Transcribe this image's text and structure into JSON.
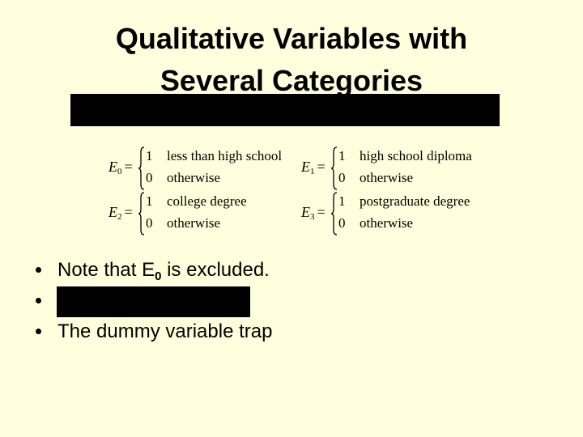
{
  "slide": {
    "title_line1": "Qualitative Variables with",
    "title_line2": "Several Categories",
    "background_color": "#ffffdd",
    "redaction_color": "#000000"
  },
  "equations": [
    {
      "var": "E",
      "sub": "0",
      "eq": "=",
      "rows": [
        {
          "value": "1",
          "label": "less than high school"
        },
        {
          "value": "0",
          "label": "otherwise"
        }
      ]
    },
    {
      "var": "E",
      "sub": "1",
      "eq": "=",
      "rows": [
        {
          "value": "1",
          "label": "high school diploma"
        },
        {
          "value": "0",
          "label": "otherwise"
        }
      ]
    },
    {
      "var": "E",
      "sub": "2",
      "eq": "=",
      "rows": [
        {
          "value": "1",
          "label": "college degree"
        },
        {
          "value": "0",
          "label": "otherwise"
        }
      ]
    },
    {
      "var": "E",
      "sub": "3",
      "eq": "=",
      "rows": [
        {
          "value": "1",
          "label": "postgraduate degree"
        },
        {
          "value": "0",
          "label": "otherwise"
        }
      ]
    }
  ],
  "bullets": [
    {
      "pre": "Note that E",
      "sub": "0",
      "post": " is excluded."
    },
    {
      "redacted": true
    },
    {
      "text": "The dummy variable trap"
    }
  ]
}
